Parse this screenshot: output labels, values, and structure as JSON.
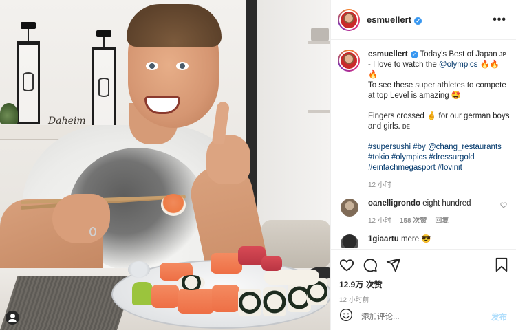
{
  "photo": {
    "wall_sign": "Daheim"
  },
  "post": {
    "username": "esmuellert",
    "verified_mark": "✓",
    "more_icon": "more-horizontal-icon",
    "caption": {
      "username": "esmuellert",
      "line1": "Today's Best of Japan",
      "jp_tag": "JP",
      "line2_prefix": "- I love to watch the ",
      "mention": "@olympics",
      "fire_emoji": "🔥🔥",
      "fire_emoji2": "🔥",
      "p2": "To see these super athletes to compete at top Level is amazing",
      "p2_emoji": "🤩",
      "p3a": "Fingers crossed",
      "p3_emoji": "🤞",
      "p3b": " for our german boys and girls.",
      "de_tag": "DE",
      "hashtags1": "#supersushi #by ",
      "mention2": "@chang_restaurants",
      "hashtags2": "#tokio #olympics #dressurgold #einfachmegasport #lovinit",
      "time": "12 小时"
    },
    "comments": [
      {
        "username": "oanelligrondo",
        "text": "eight hundred",
        "time": "12 小时",
        "likes": "158 次赞",
        "reply": "回复"
      },
      {
        "username": "1giaartu",
        "text": "mere 😎"
      }
    ],
    "likes": "12.9万 次赞",
    "time": "12 小时前",
    "add_comment_placeholder": "添加评论...",
    "post_button": "发布"
  },
  "colors": {
    "link": "#00376b",
    "verified": "#3897f0",
    "post_button": "#b2dffc",
    "meta": "#8e8e8e"
  }
}
